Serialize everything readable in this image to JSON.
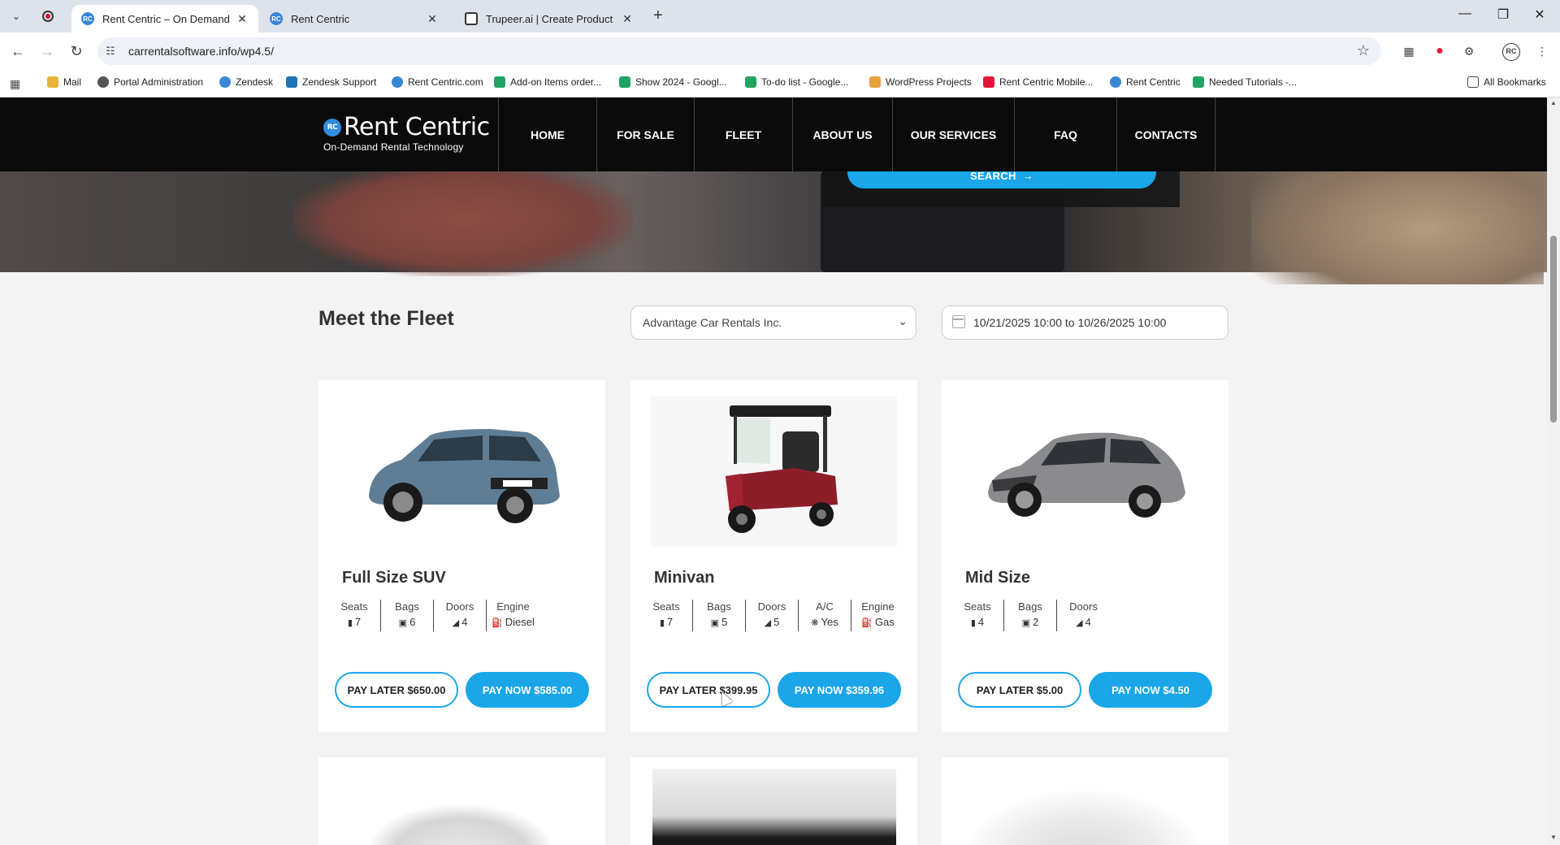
{
  "browser": {
    "tabs": [
      {
        "title": "Rent Centric – On Demand Ren",
        "favicon": "rc-favicon-icon",
        "active": true
      },
      {
        "title": "Rent Centric",
        "favicon": "rc-favicon-icon",
        "active": false
      },
      {
        "title": "Trupeer.ai | Create Product Vide",
        "favicon": "trupeer-favicon-icon",
        "active": false
      }
    ],
    "url": "carrentalsoftware.info/wp4.5/",
    "avatar_initials": "RC",
    "bookmarks": [
      {
        "label": "Mail",
        "color": "#e9b23a"
      },
      {
        "label": "Portal Administration",
        "color": "#555555"
      },
      {
        "label": "Zendesk",
        "color": "#3a86d6"
      },
      {
        "label": "Zendesk Support",
        "color": "#1f73b7"
      },
      {
        "label": "Rent Centric.com",
        "color": "#3a86d6"
      },
      {
        "label": "Add-on Items order...",
        "color": "#21a366"
      },
      {
        "label": "Show 2024 - Googl...",
        "color": "#21a366"
      },
      {
        "label": "To-do list - Google...",
        "color": "#21a366"
      },
      {
        "label": "WordPress Projects",
        "color": "#e8a33d"
      },
      {
        "label": "Rent Centric Mobile...",
        "color": "#e0163b"
      },
      {
        "label": "Rent Centric",
        "color": "#3a86d6"
      },
      {
        "label": "Needed Tutorials -...",
        "color": "#21a366"
      }
    ],
    "all_bookmarks": "All Bookmarks"
  },
  "site": {
    "brand": "Rent Centric",
    "brand_badge": "RC",
    "tagline": "On-Demand Rental Technology",
    "menu": [
      "HOME",
      "FOR SALE",
      "FLEET",
      "ABOUT US",
      "OUR SERVICES",
      "FAQ",
      "CONTACTS"
    ],
    "search_label": "SEARCH",
    "accent": "#1aa6e8"
  },
  "fleet": {
    "title": "Meet the Fleet",
    "location": "Advantage Car Rentals Inc.",
    "dates": "10/21/2025 10:00 to 10/26/2025 10:00",
    "cards": [
      {
        "name": "Full Size SUV",
        "image": "suv-image",
        "specs": [
          {
            "label": "Seats",
            "value": "7",
            "icon": "seat-icon"
          },
          {
            "label": "Bags",
            "value": "6",
            "icon": "bag-icon"
          },
          {
            "label": "Doors",
            "value": "4",
            "icon": "door-icon"
          },
          {
            "label": "Engine",
            "value": "Diesel",
            "icon": "fuel-icon"
          }
        ],
        "pay_later": "PAY LATER $650.00",
        "pay_now": "PAY NOW $585.00"
      },
      {
        "name": "Minivan",
        "image": "golf-cart-image",
        "specs": [
          {
            "label": "Seats",
            "value": "7",
            "icon": "seat-icon"
          },
          {
            "label": "Bags",
            "value": "5",
            "icon": "bag-icon"
          },
          {
            "label": "Doors",
            "value": "5",
            "icon": "door-icon"
          },
          {
            "label": "A/C",
            "value": "Yes",
            "icon": "fan-icon"
          },
          {
            "label": "Engine",
            "value": "Gas",
            "icon": "fuel-icon"
          }
        ],
        "pay_later": "PAY LATER $399.95",
        "pay_now": "PAY NOW $359.96"
      },
      {
        "name": "Mid Size",
        "image": "sedan-image",
        "specs": [
          {
            "label": "Seats",
            "value": "4",
            "icon": "seat-icon"
          },
          {
            "label": "Bags",
            "value": "2",
            "icon": "bag-icon"
          },
          {
            "label": "Doors",
            "value": "4",
            "icon": "door-icon"
          }
        ],
        "pay_later": "PAY LATER $5.00",
        "pay_now": "PAY NOW $4.50"
      }
    ]
  }
}
